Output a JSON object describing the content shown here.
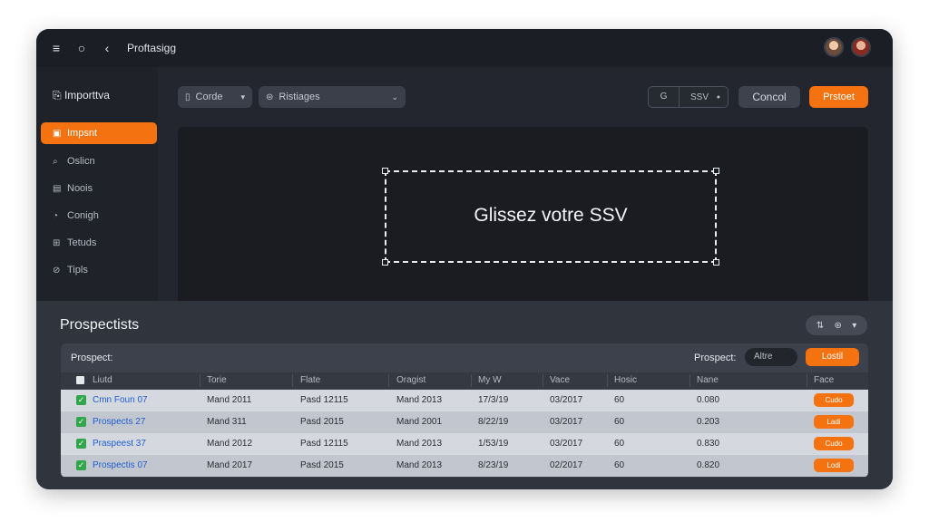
{
  "titlebar": {
    "menu_icon": "menu-icon",
    "title": "Proftasigg",
    "avatars": [
      "user-avatar-1",
      "user-avatar-2"
    ]
  },
  "sidebar": {
    "heading": "Importtva",
    "items": [
      {
        "label": "Impsnt",
        "icon": "import-icon",
        "active": true
      },
      {
        "label": "Oslicn",
        "icon": "search-icon",
        "active": false
      },
      {
        "label": "Noois",
        "icon": "notes-icon",
        "active": false
      },
      {
        "label": "Conigh",
        "icon": "config-icon",
        "active": false
      },
      {
        "label": "Tetuds",
        "icon": "tools-icon",
        "active": false
      },
      {
        "label": "Tipls",
        "icon": "tips-icon",
        "active": false
      }
    ]
  },
  "toolbar": {
    "source_select": "Corde",
    "mapping_select": "Ristiages",
    "format_left": "G",
    "format_right": "SSV",
    "cancel_label": "Concol",
    "primary_label": "Prstoet"
  },
  "dropzone": {
    "text": "Glissez votre SSV"
  },
  "prospects": {
    "title": "Prospectists",
    "table_label": "Prospect:",
    "filter_label": "Prospect:",
    "filter_value": "Altre",
    "filter_button": "Lostil",
    "columns": [
      "Liutd",
      "Torie",
      "Flate",
      "Oragist",
      "My W",
      "Vace",
      "Hosic",
      "Nane",
      "Face"
    ],
    "rows": [
      {
        "name": "Cmn Foun 07",
        "c1": "Mand 2011",
        "c2": "Pasd 12115",
        "c3": "Mand 2013",
        "c4": "17/3/19",
        "c5": "03/2017",
        "c6": "60",
        "c7": "0.080",
        "action": "Cudo"
      },
      {
        "name": "Prospects 27",
        "c1": "Mand 311",
        "c2": "Pasd 2015",
        "c3": "Mand 2001",
        "c4": "8/22/19",
        "c5": "03/2017",
        "c6": "60",
        "c7": "0.203",
        "action": "Ladi"
      },
      {
        "name": "Praspeest 37",
        "c1": "Mand 2012",
        "c2": "Pasd 12115",
        "c3": "Mand 2013",
        "c4": "1/53/19",
        "c5": "03/2017",
        "c6": "60",
        "c7": "0.830",
        "action": "Cudo"
      },
      {
        "name": "Prospectis 07",
        "c1": "Mand 2017",
        "c2": "Pasd 2015",
        "c3": "Mand 2013",
        "c4": "8/23/19",
        "c5": "02/2017",
        "c6": "60",
        "c7": "0.820",
        "action": "Lodi"
      }
    ]
  },
  "colors": {
    "accent": "#f4720f",
    "window_bg": "#23262e",
    "check_green": "#2fa64a",
    "link_blue": "#1f5fd1"
  }
}
